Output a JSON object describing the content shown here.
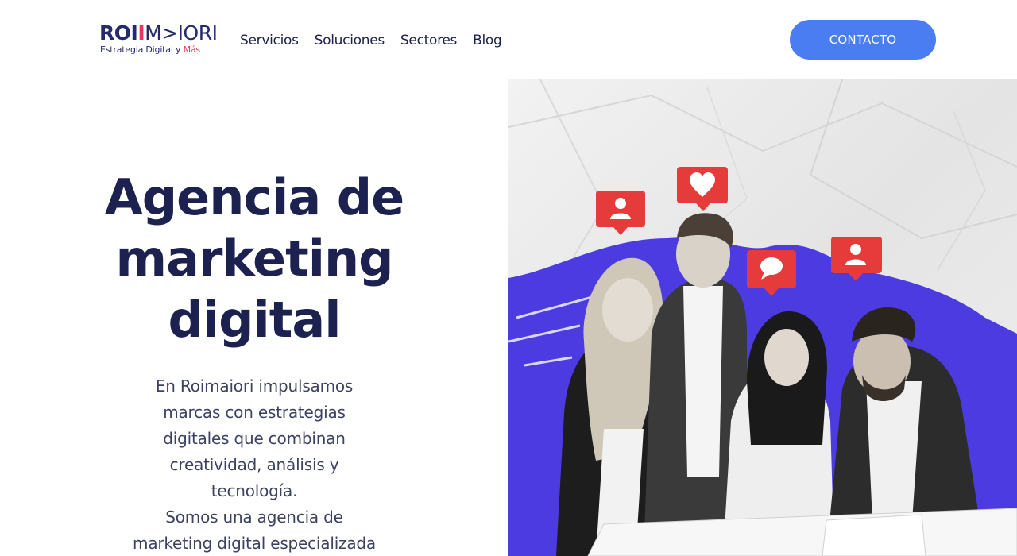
{
  "logo": {
    "roi": "ROI",
    "i_red": "I",
    "rest": "M>IORI",
    "tagline": "Estrategia Digital y",
    "tagline_accent": "Más"
  },
  "nav": {
    "items": [
      "Servicios",
      "Soluciones",
      "Sectores",
      "Blog"
    ]
  },
  "cta": {
    "label": "CONTACTO"
  },
  "hero": {
    "title_lines": [
      "Agencia de",
      "marketing",
      "digital"
    ],
    "description_lines": [
      "En Roimaiori impulsamos",
      "marcas con estrategias",
      "digitales que combinan",
      "creatividad, análisis y",
      "tecnología.",
      "Somos una agencia de",
      "marketing digital especializada"
    ]
  },
  "image": {
    "icons": [
      "user-notification-icon",
      "heart-notification-icon",
      "comment-notification-icon",
      "user-notification-icon"
    ]
  },
  "colors": {
    "navy": "#1c2150",
    "accent_blue": "#4a7df2",
    "brand_red": "#e8395a",
    "notification_red": "#e63b3b",
    "scribble_blue": "#4b3be0"
  }
}
